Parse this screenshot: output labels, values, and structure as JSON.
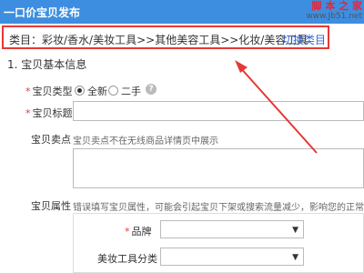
{
  "header": {
    "title": "一口价宝贝发布"
  },
  "watermark": {
    "line1": "脚 本 之 家",
    "line2": "www.Jb51.net"
  },
  "category": {
    "path_text": "类目：彩妆/香水/美妆工具>>其他美容工具>>化妆/美容工具",
    "switch_label": "切换类目"
  },
  "section": {
    "title": "1. 宝贝基本信息"
  },
  "fields": {
    "type": {
      "label": "宝贝类型",
      "options": [
        "全新",
        "二手"
      ],
      "selected": "全新"
    },
    "title": {
      "label": "宝贝标题",
      "value": ""
    },
    "selling_point": {
      "label": "宝贝卖点",
      "hint": "宝贝卖点不在无线商品详情页中展示"
    },
    "attributes": {
      "label": "宝贝属性",
      "hint": "错误填写宝贝属性，可能会引起宝贝下架或搜索流量减少，影响您的正常销售",
      "brand_label": "品牌",
      "tool_category_label": "美妆工具分类"
    }
  },
  "icons": {
    "help": "question-icon",
    "dropdown": "chevron-down-icon"
  },
  "colors": {
    "header": "#3d8ee0",
    "highlight": "#e53935",
    "link": "#3366cc"
  }
}
